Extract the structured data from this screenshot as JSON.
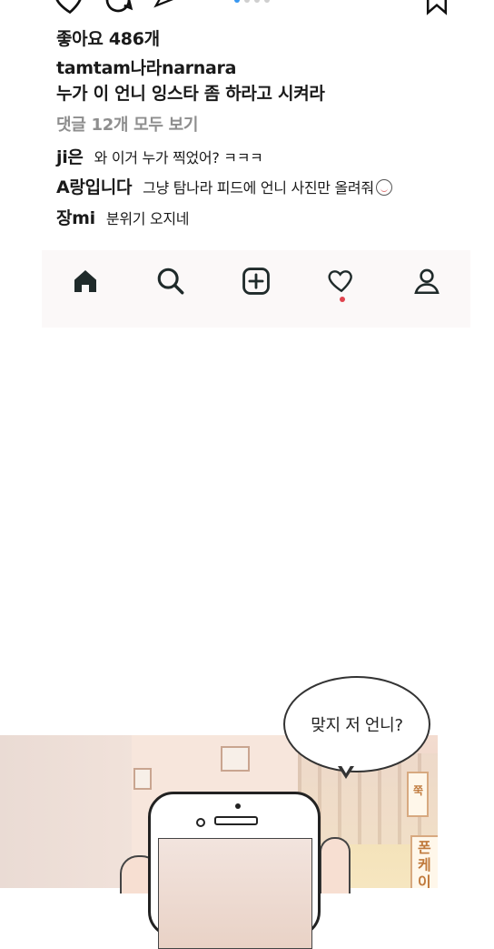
{
  "post": {
    "carousel": {
      "count": 4,
      "active_index": 0
    },
    "likes_text": "좋아요 486개",
    "caption_user": "tamtam나라narnara",
    "caption_text": "누가 이 언니 잉스타  좀 하라고 시켜라",
    "view_comments_text": "댓글 12개 모두 보기",
    "comments": [
      {
        "user": "ji은",
        "text": "와 이거 누가 찍었어? ㅋㅋㅋ"
      },
      {
        "user": "A랑입니다",
        "text": "그냥 탐나라 피드에 언니 사진만 올려줘"
      },
      {
        "user": "장mi",
        "text": "분위기 오지네"
      }
    ]
  },
  "nav": {
    "items": [
      {
        "name": "home",
        "icon": "home-icon"
      },
      {
        "name": "search",
        "icon": "search-icon"
      },
      {
        "name": "add",
        "icon": "plus-square-icon"
      },
      {
        "name": "activity",
        "icon": "heart-icon"
      },
      {
        "name": "profile",
        "icon": "user-icon"
      }
    ],
    "notification_color": "#e0434e"
  },
  "comic": {
    "speech_bubble": "맞지 저 언니?",
    "sign_1": "쭉",
    "sign_2": "폰\n케\n이"
  },
  "colors": {
    "accent": "#3897f0",
    "text": "#1a1a1a",
    "muted": "#8e8e8e",
    "nav_bg": "#fbf8f8"
  }
}
